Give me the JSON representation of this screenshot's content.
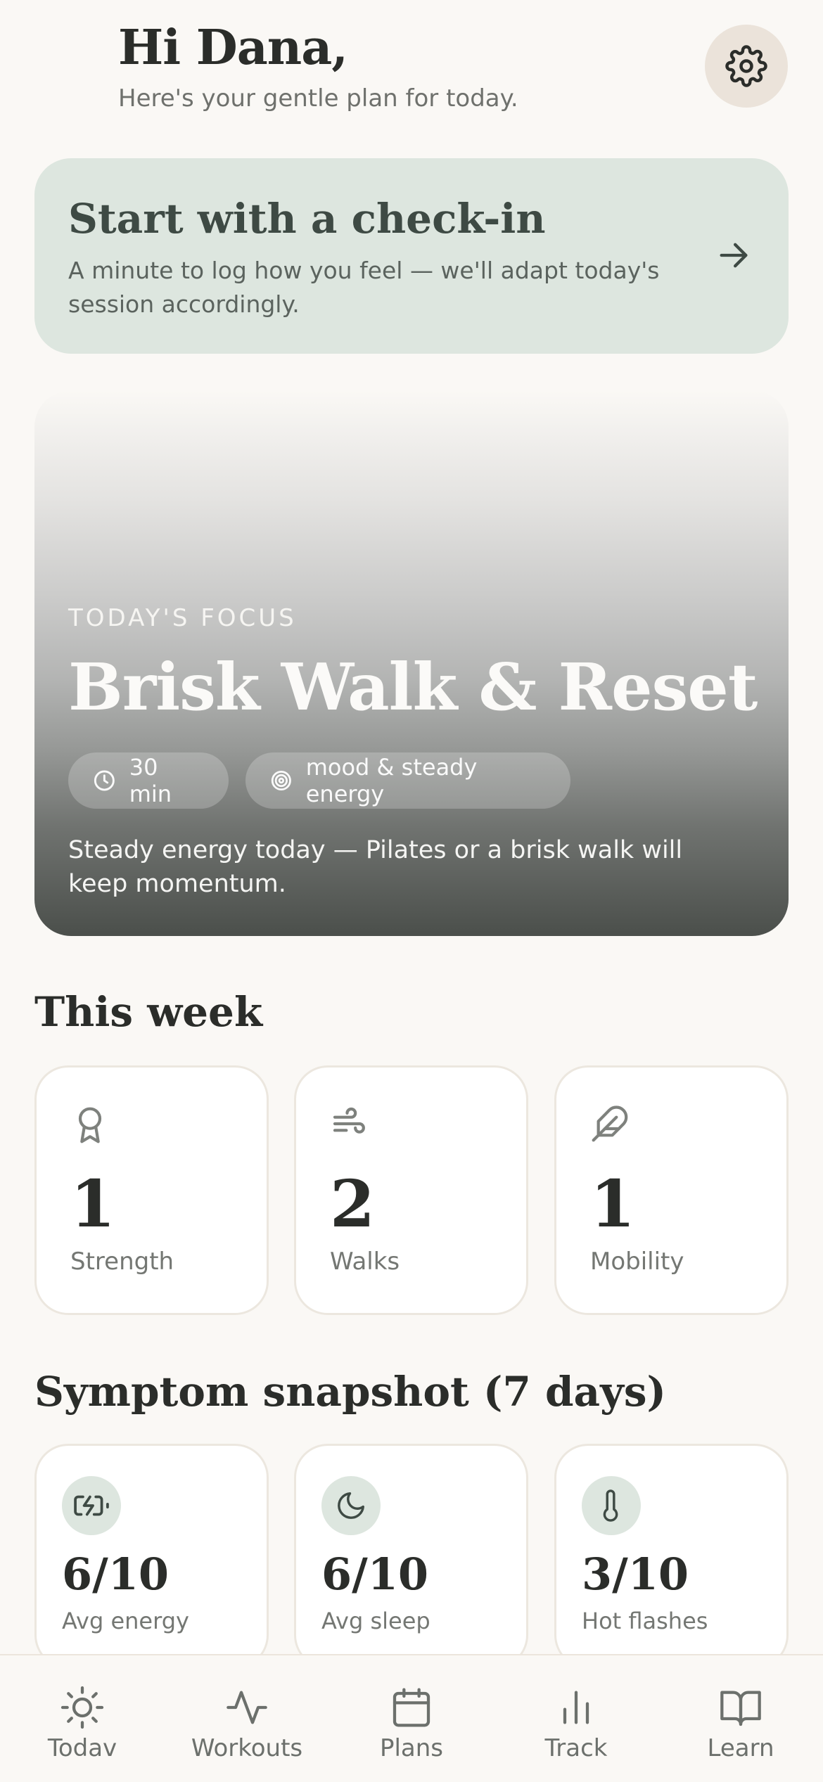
{
  "header": {
    "greeting": "Hi Dana,",
    "subtitle": "Here's your gentle plan for today."
  },
  "checkin": {
    "title": "Start with a check-in",
    "description": "A minute to log how you feel — we'll adapt today's session accordingly."
  },
  "focus": {
    "label": "TODAY'S FOCUS",
    "title": "Brisk Walk & Reset",
    "duration": "30 min",
    "goal": "mood & steady energy",
    "description": "Steady energy today — Pilates or a brisk walk will keep momentum."
  },
  "week": {
    "title": "This week",
    "items": [
      {
        "value": "1",
        "label": "Strength",
        "icon": "award-icon"
      },
      {
        "value": "2",
        "label": "Walks",
        "icon": "wind-icon"
      },
      {
        "value": "1",
        "label": "Mobility",
        "icon": "feather-icon"
      }
    ]
  },
  "symptoms": {
    "title": "Symptom snapshot (7 days)",
    "items": [
      {
        "value": "6/10",
        "label": "Avg energy",
        "icon": "battery-charging-icon"
      },
      {
        "value": "6/10",
        "label": "Avg sleep",
        "icon": "moon-icon"
      },
      {
        "value": "3/10",
        "label": "Hot flashes",
        "icon": "thermometer-icon"
      }
    ]
  },
  "nav": {
    "items": [
      {
        "label": "Todav",
        "icon": "sun-icon"
      },
      {
        "label": "Workouts",
        "icon": "activity-icon"
      },
      {
        "label": "Plans",
        "icon": "calendar-icon"
      },
      {
        "label": "Track",
        "icon": "bar-chart-icon"
      },
      {
        "label": "Learn",
        "icon": "book-open-icon"
      }
    ]
  },
  "colors": {
    "background": "#faf8f5",
    "accent_soft": "#dde6df",
    "settings_bg": "#ebe3da",
    "text_primary": "#2b2d2a"
  }
}
